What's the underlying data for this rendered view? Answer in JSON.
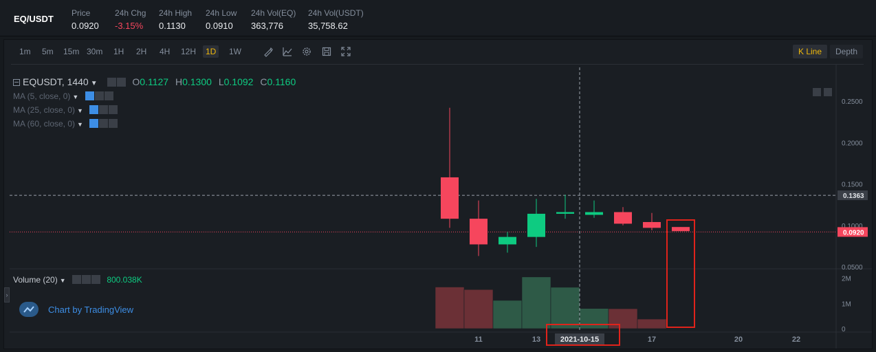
{
  "header": {
    "pair": "EQ/USDT",
    "stats": [
      {
        "label": "Price",
        "value": "0.0920",
        "negative": false
      },
      {
        "label": "24h Chg",
        "value": "-3.15%",
        "negative": true
      },
      {
        "label": "24h High",
        "value": "0.1130",
        "negative": false
      },
      {
        "label": "24h Low",
        "value": "0.0910",
        "negative": false
      },
      {
        "label": "24h Vol(EQ)",
        "value": "363,776",
        "negative": false
      },
      {
        "label": "24h Vol(USDT)",
        "value": "35,758.62",
        "negative": false
      }
    ]
  },
  "toolbar": {
    "timeframes": [
      "1m",
      "5m",
      "15m",
      "30m",
      "1H",
      "2H",
      "4H",
      "12H",
      "1D",
      "1W"
    ],
    "active_timeframe": "1D",
    "kline_label": "K Line",
    "depth_label": "Depth",
    "icons": [
      "draw-icon",
      "indicator-icon",
      "settings-icon",
      "save-icon",
      "fullscreen-icon"
    ]
  },
  "legend": {
    "symbol": "EQUSDT, 1440",
    "open_k": "O",
    "open": "0.1127",
    "high_k": "H",
    "high": "0.1300",
    "low_k": "L",
    "low": "0.1092",
    "close_k": "C",
    "close": "0.1160",
    "ma": [
      "MA (5, close, 0)",
      "MA (25, close, 0)",
      "MA (60, close, 0)"
    ],
    "volume_label": "Volume (20)",
    "volume_value": "800.038K"
  },
  "branding": {
    "text": "Chart by TradingView"
  },
  "chart_data": {
    "type": "candlestick",
    "title": "",
    "price_axis": {
      "ticks": [
        "0.2500",
        "0.2000",
        "0.1500",
        "0.1000",
        "0.0500"
      ],
      "tick_values": [
        0.25,
        0.2,
        0.15,
        0.1,
        0.05
      ],
      "ylim": [
        0.0475,
        0.2875
      ]
    },
    "volume_axis": {
      "ticks": [
        "2M",
        "1M",
        "0"
      ],
      "tick_values": [
        2000000,
        1000000,
        0
      ],
      "ylim": [
        0,
        2100000
      ]
    },
    "x_ticks": [
      {
        "label": "11",
        "index": 1
      },
      {
        "label": "13",
        "index": 3
      },
      {
        "label": "15",
        "index": 5
      },
      {
        "label": "17",
        "index": 7
      },
      {
        "label": "20",
        "index": 10
      },
      {
        "label": "22",
        "index": 12
      }
    ],
    "crosshair": {
      "date_label": "2021-10-15",
      "index": 4.5,
      "price_label": "0.1363",
      "price": 0.1363
    },
    "last_price": {
      "label": "0.0920",
      "value": 0.092
    },
    "candles": [
      {
        "open": 0.158,
        "high": 0.242,
        "low": 0.097,
        "close": 0.108,
        "volume": 1650000
      },
      {
        "open": 0.108,
        "high": 0.13,
        "low": 0.063,
        "close": 0.077,
        "volume": 1550000
      },
      {
        "open": 0.077,
        "high": 0.092,
        "low": 0.067,
        "close": 0.086,
        "volume": 1120000
      },
      {
        "open": 0.086,
        "high": 0.132,
        "low": 0.074,
        "close": 0.114,
        "volume": 2050000
      },
      {
        "open": 0.114,
        "high": 0.137,
        "low": 0.108,
        "close": 0.116,
        "volume": 1640000
      },
      {
        "open": 0.1127,
        "high": 0.13,
        "low": 0.1092,
        "close": 0.116,
        "volume": 800038
      },
      {
        "open": 0.116,
        "high": 0.122,
        "low": 0.1,
        "close": 0.102,
        "volume": 790000
      },
      {
        "open": 0.104,
        "high": 0.115,
        "low": 0.094,
        "close": 0.097,
        "volume": 380000
      },
      {
        "open": 0.098,
        "high": 0.098,
        "low": 0.093,
        "close": 0.093,
        "volume": 0
      }
    ],
    "colors": {
      "up": "#0ecb81",
      "down": "#f6465d",
      "up_vol": "#2e5a47",
      "down_vol": "#6b3036",
      "annotation": "#e0231b"
    },
    "annotations": [
      {
        "type": "box",
        "target": "candle",
        "index": 8
      },
      {
        "type": "box",
        "target": "date_label",
        "text": "2021-10-15"
      }
    ]
  }
}
